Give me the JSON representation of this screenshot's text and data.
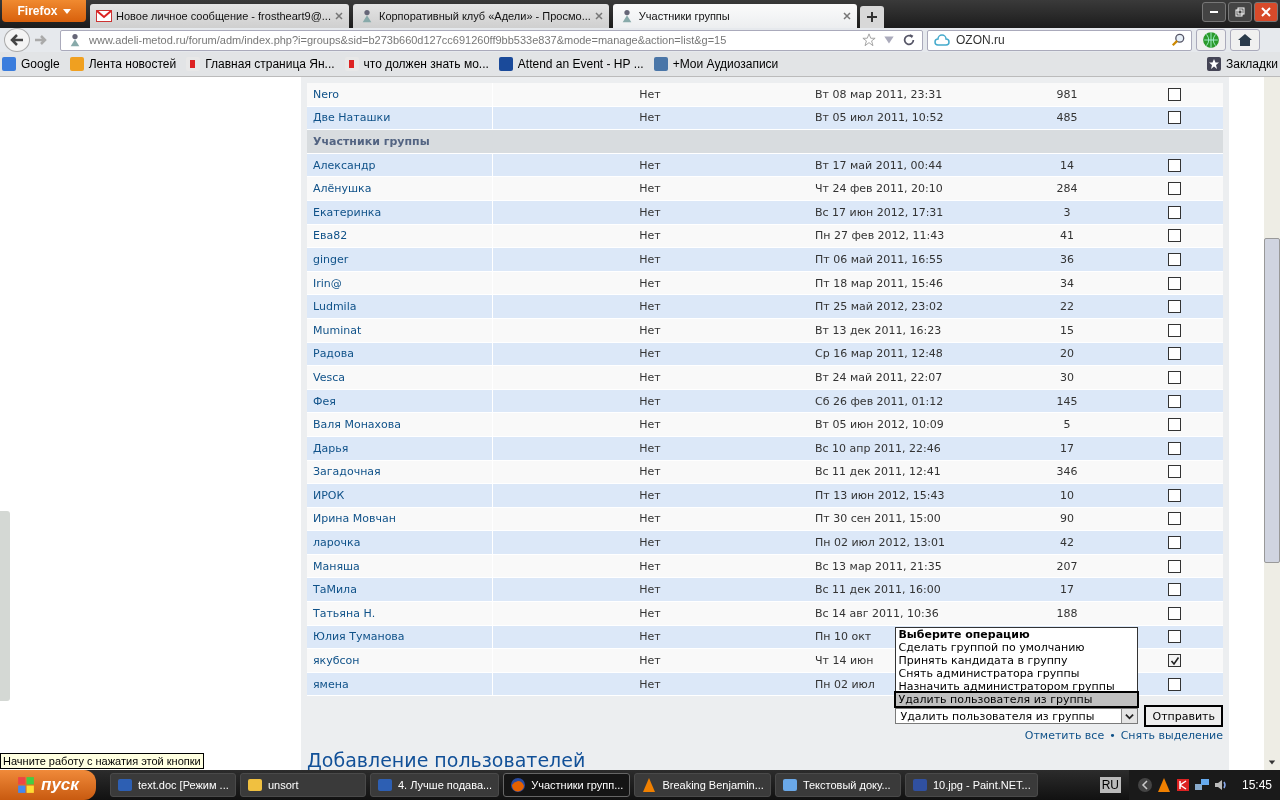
{
  "browser": {
    "menu_button": "Firefox",
    "tabs": [
      {
        "title": "Новое личное сообщение - frostheart9@...",
        "kind": "mail",
        "selected": false
      },
      {
        "title": "Корпоративный клуб «Адели» - Просмо...",
        "kind": "site",
        "selected": false
      },
      {
        "title": "Участники группы",
        "kind": "site",
        "selected": true
      }
    ],
    "url": "www.adeli-metod.ru/forum/adm/index.php?i=groups&sid=b273b660d127cc691260ff9bb533e837&mode=manage&action=list&g=15",
    "search": "OZON.ru",
    "bookmarks": [
      {
        "label": "Google",
        "kind": "google"
      },
      {
        "label": "Лента новостей",
        "kind": "rss"
      },
      {
        "label": "Главная страница Ян...",
        "kind": "yandex"
      },
      {
        "label": "что должен знать мо...",
        "kind": "yandex"
      },
      {
        "label": "Attend an Event - HP ...",
        "kind": "hp"
      },
      {
        "label": "+Мои Аудиозаписи",
        "kind": "vk"
      }
    ],
    "bookmarks_menu": "Закладки"
  },
  "table": {
    "rows": [
      {
        "kind": "member",
        "name": "Nero",
        "col2": "Нет",
        "date": "Вт 08 мар 2011, 23:31",
        "posts": "981",
        "checked": false
      },
      {
        "kind": "member",
        "name": "Две Наташки",
        "col2": "Нет",
        "date": "Вт 05 июл 2011, 10:52",
        "posts": "485",
        "checked": false
      },
      {
        "kind": "section",
        "name": "Участники группы"
      },
      {
        "kind": "member",
        "name": "Александр",
        "col2": "Нет",
        "date": "Вт 17 май 2011, 00:44",
        "posts": "14",
        "checked": false
      },
      {
        "kind": "member",
        "name": "Алёнушка",
        "col2": "Нет",
        "date": "Чт 24 фев 2011, 20:10",
        "posts": "284",
        "checked": false
      },
      {
        "kind": "member",
        "name": "Екатеринка",
        "col2": "Нет",
        "date": "Вс 17 июн 2012, 17:31",
        "posts": "3",
        "checked": false
      },
      {
        "kind": "member",
        "name": "Ева82",
        "col2": "Нет",
        "date": "Пн 27 фев 2012, 11:43",
        "posts": "41",
        "checked": false
      },
      {
        "kind": "member",
        "name": "ginger",
        "col2": "Нет",
        "date": "Пт 06 май 2011, 16:55",
        "posts": "36",
        "checked": false
      },
      {
        "kind": "member",
        "name": "Irin@",
        "col2": "Нет",
        "date": "Пт 18 мар 2011, 15:46",
        "posts": "34",
        "checked": false
      },
      {
        "kind": "member",
        "name": "Ludmila",
        "col2": "Нет",
        "date": "Пт 25 май 2012, 23:02",
        "posts": "22",
        "checked": false
      },
      {
        "kind": "member",
        "name": "Muminat",
        "col2": "Нет",
        "date": "Вт 13 дек 2011, 16:23",
        "posts": "15",
        "checked": false
      },
      {
        "kind": "member",
        "name": "Радова",
        "col2": "Нет",
        "date": "Ср 16 мар 2011, 12:48",
        "posts": "20",
        "checked": false
      },
      {
        "kind": "member",
        "name": "Vesca",
        "col2": "Нет",
        "date": "Вт 24 май 2011, 22:07",
        "posts": "30",
        "checked": false
      },
      {
        "kind": "member",
        "name": "Фея",
        "col2": "Нет",
        "date": "Сб 26 фев 2011, 01:12",
        "posts": "145",
        "checked": false
      },
      {
        "kind": "member",
        "name": "Валя Монахова",
        "col2": "Нет",
        "date": "Вт 05 июн 2012, 10:09",
        "posts": "5",
        "checked": false
      },
      {
        "kind": "member",
        "name": "Дарья",
        "col2": "Нет",
        "date": "Вс 10 апр 2011, 22:46",
        "posts": "17",
        "checked": false
      },
      {
        "kind": "member",
        "name": "Загадочная",
        "col2": "Нет",
        "date": "Вс 11 дек 2011, 12:41",
        "posts": "346",
        "checked": false
      },
      {
        "kind": "member",
        "name": "ИРОК",
        "col2": "Нет",
        "date": "Пт 13 июн 2012, 15:43",
        "posts": "10",
        "checked": false
      },
      {
        "kind": "member",
        "name": "Ирина Мовчан",
        "col2": "Нет",
        "date": "Пт 30 сен 2011, 15:00",
        "posts": "90",
        "checked": false
      },
      {
        "kind": "member",
        "name": "ларочка",
        "col2": "Нет",
        "date": "Пн 02 июл 2012, 13:01",
        "posts": "42",
        "checked": false
      },
      {
        "kind": "member",
        "name": "Маняша",
        "col2": "Нет",
        "date": "Вс 13 мар 2011, 21:35",
        "posts": "207",
        "checked": false
      },
      {
        "kind": "member",
        "name": "ТаМила",
        "col2": "Нет",
        "date": "Вс 11 дек 2011, 16:00",
        "posts": "17",
        "checked": false
      },
      {
        "kind": "member",
        "name": "Татьяна Н.",
        "col2": "Нет",
        "date": "Вс 14 авг 2011, 10:36",
        "posts": "188",
        "checked": false
      },
      {
        "kind": "member",
        "name": "Юлия Туманова",
        "col2": "Нет",
        "date": "Пн 10 окт",
        "checked": false
      },
      {
        "kind": "member",
        "name": "якубсон",
        "col2": "Нет",
        "date": "Чт 14 июн",
        "checked": true
      },
      {
        "kind": "member",
        "name": "ямена",
        "col2": "Нет",
        "date": "Пн 02 июл",
        "checked": false
      }
    ]
  },
  "operation": {
    "options": [
      {
        "label": "Выберите операцию",
        "kind": "header",
        "selected": false
      },
      {
        "label": "Сделать группой по умолчанию",
        "kind": "option",
        "selected": false
      },
      {
        "label": "Принять кандидата в группу",
        "kind": "option",
        "selected": false
      },
      {
        "label": "Снять администратора группы",
        "kind": "option",
        "selected": false
      },
      {
        "label": "Назначить администратором группы",
        "kind": "option",
        "selected": false
      },
      {
        "label": "Удалить пользователя из группы",
        "kind": "option",
        "selected": true
      }
    ],
    "value": "Удалить пользователя из группы",
    "submit": "Отправить",
    "mark_all": "Отметить все",
    "separator": "•",
    "unmark_all": "Снять выделение"
  },
  "heading": "Добавление пользователей",
  "tooltip": "Начните работу с нажатия этой кнопки",
  "taskbar": {
    "start": "пуск",
    "items": [
      {
        "label": "text.doc [Режим ...",
        "kind": "word",
        "selected": false
      },
      {
        "label": "unsort",
        "kind": "folder",
        "selected": false
      },
      {
        "label": "4. Лучше подава...",
        "kind": "word",
        "selected": false
      },
      {
        "label": "Участники групп...",
        "kind": "firefox",
        "selected": true
      },
      {
        "label": "Breaking Benjamin...",
        "kind": "vlc",
        "selected": false
      },
      {
        "label": "Текстовый доку...",
        "kind": "notepad",
        "selected": false
      },
      {
        "label": "10.jpg - Paint.NET...",
        "kind": "paint",
        "selected": false
      }
    ],
    "language": "RU",
    "clock": "15:45"
  }
}
